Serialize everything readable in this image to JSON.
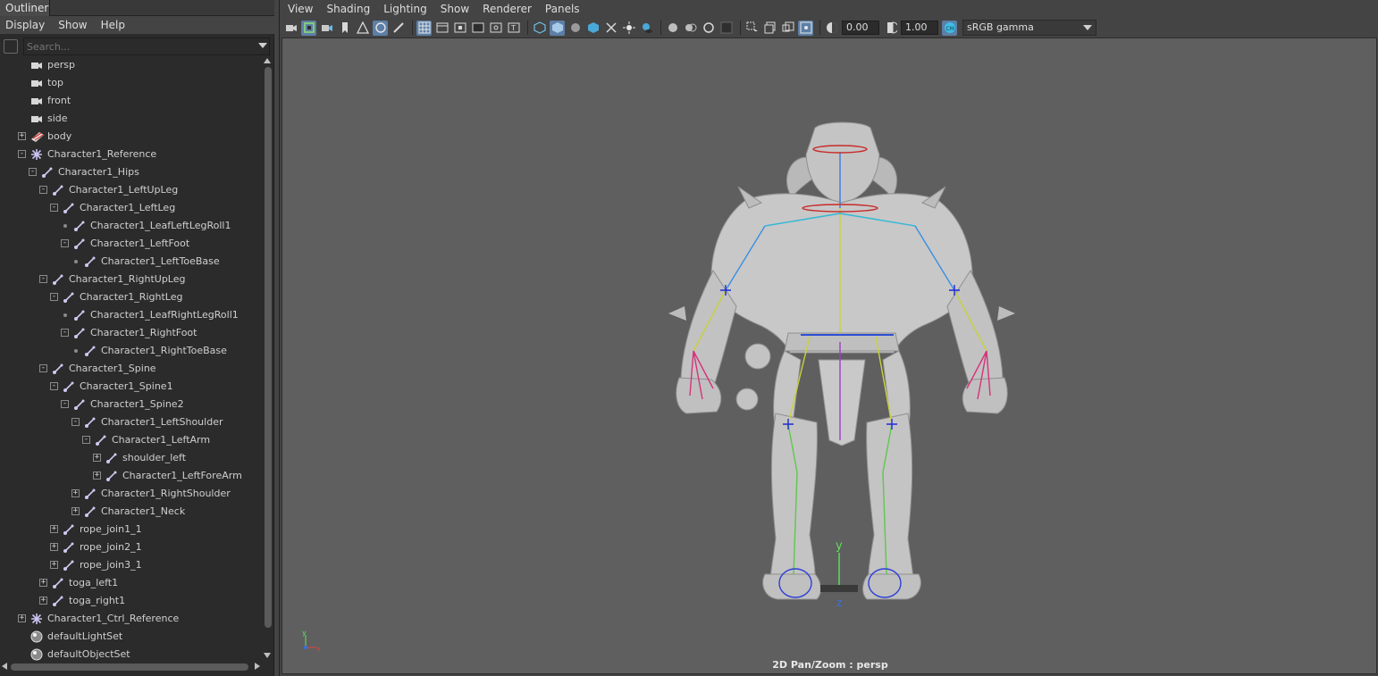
{
  "outliner": {
    "tab_label": "Outliner",
    "menu": [
      "Display",
      "Show",
      "Help"
    ],
    "search_placeholder": "Search...",
    "items": [
      {
        "label": "persp",
        "depth": 0,
        "icon": "camera-icon",
        "expander": "none"
      },
      {
        "label": "top",
        "depth": 0,
        "icon": "camera-icon",
        "expander": "none"
      },
      {
        "label": "front",
        "depth": 0,
        "icon": "camera-icon",
        "expander": "none"
      },
      {
        "label": "side",
        "depth": 0,
        "icon": "camera-icon",
        "expander": "none"
      },
      {
        "label": "body",
        "depth": 0,
        "icon": "mesh-icon",
        "expander": "collapsed"
      },
      {
        "label": "Character1_Reference",
        "depth": 0,
        "icon": "reference-icon",
        "expander": "expanded"
      },
      {
        "label": "Character1_Hips",
        "depth": 1,
        "icon": "joint-icon",
        "expander": "expanded"
      },
      {
        "label": "Character1_LeftUpLeg",
        "depth": 2,
        "icon": "joint-icon",
        "expander": "expanded"
      },
      {
        "label": "Character1_LeftLeg",
        "depth": 3,
        "icon": "joint-icon",
        "expander": "expanded"
      },
      {
        "label": "Character1_LeafLeftLegRoll1",
        "depth": 4,
        "icon": "joint-icon",
        "expander": "leaf"
      },
      {
        "label": "Character1_LeftFoot",
        "depth": 4,
        "icon": "joint-icon",
        "expander": "expanded"
      },
      {
        "label": "Character1_LeftToeBase",
        "depth": 5,
        "icon": "joint-icon",
        "expander": "leaf"
      },
      {
        "label": "Character1_RightUpLeg",
        "depth": 2,
        "icon": "joint-icon",
        "expander": "expanded"
      },
      {
        "label": "Character1_RightLeg",
        "depth": 3,
        "icon": "joint-icon",
        "expander": "expanded"
      },
      {
        "label": "Character1_LeafRightLegRoll1",
        "depth": 4,
        "icon": "joint-icon",
        "expander": "leaf"
      },
      {
        "label": "Character1_RightFoot",
        "depth": 4,
        "icon": "joint-icon",
        "expander": "expanded"
      },
      {
        "label": "Character1_RightToeBase",
        "depth": 5,
        "icon": "joint-icon",
        "expander": "leaf"
      },
      {
        "label": "Character1_Spine",
        "depth": 2,
        "icon": "joint-icon",
        "expander": "expanded"
      },
      {
        "label": "Character1_Spine1",
        "depth": 3,
        "icon": "joint-icon",
        "expander": "expanded"
      },
      {
        "label": "Character1_Spine2",
        "depth": 4,
        "icon": "joint-icon",
        "expander": "expanded"
      },
      {
        "label": "Character1_LeftShoulder",
        "depth": 5,
        "icon": "joint-icon",
        "expander": "expanded"
      },
      {
        "label": "Character1_LeftArm",
        "depth": 6,
        "icon": "joint-icon",
        "expander": "expanded"
      },
      {
        "label": "shoulder_left",
        "depth": 7,
        "icon": "joint-icon",
        "expander": "collapsed"
      },
      {
        "label": "Character1_LeftForeArm",
        "depth": 7,
        "icon": "joint-icon",
        "expander": "collapsed"
      },
      {
        "label": "Character1_RightShoulder",
        "depth": 5,
        "icon": "joint-icon",
        "expander": "collapsed"
      },
      {
        "label": "Character1_Neck",
        "depth": 5,
        "icon": "joint-icon",
        "expander": "collapsed"
      },
      {
        "label": "rope_join1_1",
        "depth": 3,
        "icon": "joint-icon",
        "expander": "collapsed"
      },
      {
        "label": "rope_join2_1",
        "depth": 3,
        "icon": "joint-icon",
        "expander": "collapsed"
      },
      {
        "label": "rope_join3_1",
        "depth": 3,
        "icon": "joint-icon",
        "expander": "collapsed"
      },
      {
        "label": "toga_left1",
        "depth": 2,
        "icon": "joint-icon",
        "expander": "collapsed"
      },
      {
        "label": "toga_right1",
        "depth": 2,
        "icon": "joint-icon",
        "expander": "collapsed"
      },
      {
        "label": "Character1_Ctrl_Reference",
        "depth": 0,
        "icon": "reference-icon",
        "expander": "collapsed"
      },
      {
        "label": "defaultLightSet",
        "depth": 0,
        "icon": "set-icon",
        "expander": "none"
      },
      {
        "label": "defaultObjectSet",
        "depth": 0,
        "icon": "set-icon",
        "expander": "none"
      }
    ]
  },
  "viewport": {
    "menu": [
      "View",
      "Shading",
      "Lighting",
      "Show",
      "Renderer",
      "Panels"
    ],
    "exposure_value": "0.00",
    "gamma_value": "1.00",
    "color_management": "sRGB gamma",
    "hud_label": "2D Pan/Zoom : persp",
    "axis_y": "y",
    "axis_z": "z",
    "gizmo_y": "y",
    "gizmo_x": "x",
    "accent_color": "#5d7fa6",
    "background_color": "#5f5f5f"
  }
}
